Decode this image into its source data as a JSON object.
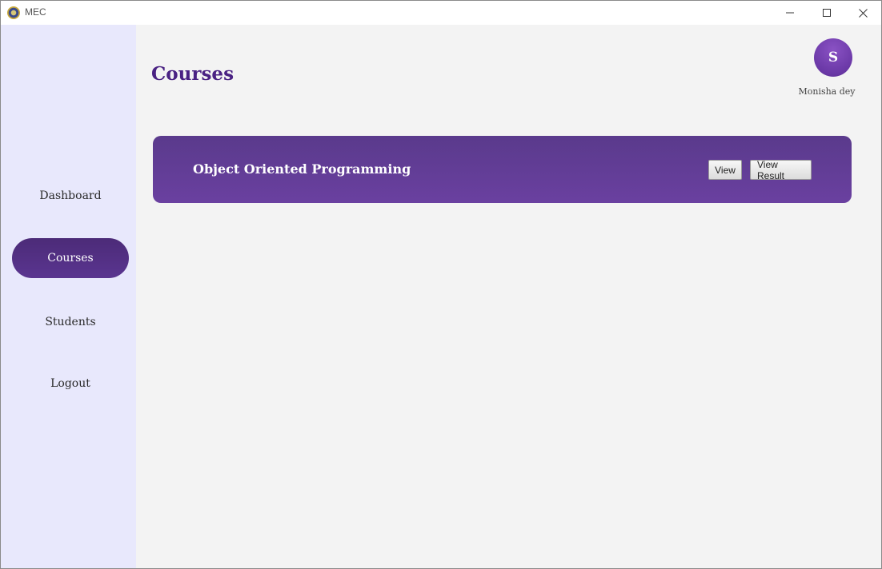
{
  "window": {
    "title": "MEC"
  },
  "sidebar": {
    "items": [
      {
        "label": "Dashboard",
        "active": false
      },
      {
        "label": "Courses",
        "active": true
      },
      {
        "label": "Students",
        "active": false
      },
      {
        "label": "Logout",
        "active": false
      }
    ]
  },
  "header": {
    "page_title": "Courses",
    "avatar_initial": "S",
    "user_name": "Monisha dey"
  },
  "courses": [
    {
      "title": "Object Oriented Programming",
      "view_label": "View",
      "result_label": "View Result"
    }
  ],
  "colors": {
    "accent": "#4a2283",
    "card": "#5f3c94",
    "sidebar_bg": "#e8e8fc",
    "active_nav": "#52307f"
  },
  "icons": {
    "app": "app-logo-icon",
    "minimize": "minimize-icon",
    "maximize": "maximize-icon",
    "close": "close-icon"
  }
}
